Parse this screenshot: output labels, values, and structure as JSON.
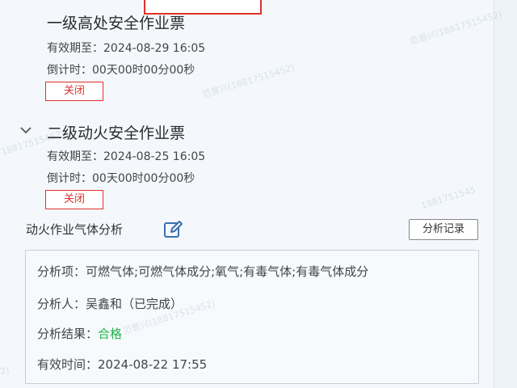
{
  "permits": [
    {
      "title": "一级高处安全作业票",
      "validity": "有效期至：2024-08-29 16:05",
      "countdown": "倒计时：00天00时00分00秒",
      "status": "关闭"
    },
    {
      "title": "二级动火安全作业票",
      "validity": "有效期至：2024-08-25 16:05",
      "countdown": "倒计时：00天00时00分00秒",
      "status": "关闭",
      "expand_icon": "chevron-down-icon"
    }
  ],
  "gas_analysis": {
    "section_title": "动火作业气体分析",
    "edit_icon": "edit-icon",
    "record_button": "分析记录",
    "items_label": "分析项：",
    "items_value": "可燃气体;可燃气体成分;氧气;有毒气体;有毒气体成分",
    "analyst_label": "分析人：",
    "analyst_value": "吴鑫和（已完成）",
    "result_label": "分析结果：",
    "result_value": "合格",
    "valid_time_label": "有效时间：",
    "valid_time_value": "2024-08-22 17:55"
  },
  "watermark": {
    "text_a": "范晋兴(18817515452)",
    "text_b": "18817515452)",
    "text_c": "范普兴(18817515452)",
    "text_d": "1881751545",
    "text_e": "2)"
  },
  "colors": {
    "danger": "#e0302c",
    "success": "#22b14c",
    "accent": "#3a6fb0"
  }
}
